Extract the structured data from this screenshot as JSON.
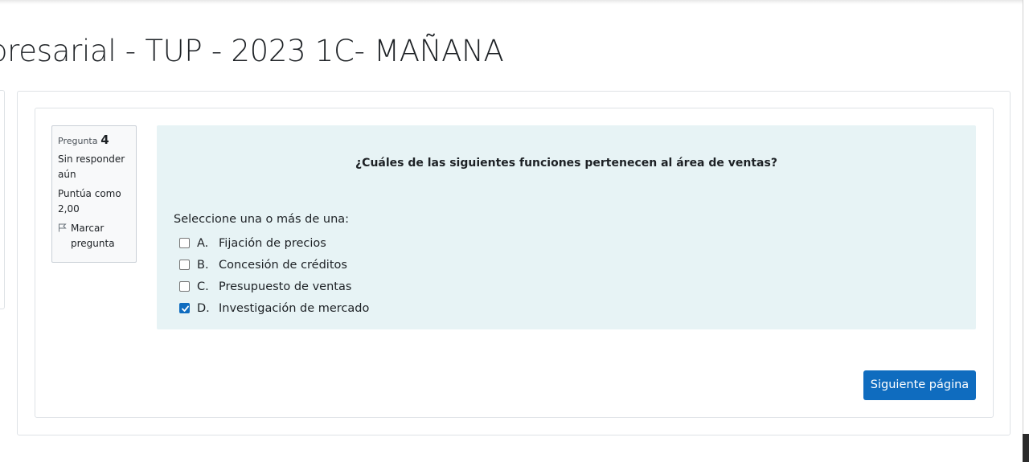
{
  "page": {
    "title": "presarial - TUP - 2023 1C- MAÑANA"
  },
  "question_info": {
    "label": "Pregunta",
    "number": "4",
    "state": "Sin responder aún",
    "grade": "Puntúa como 2,00",
    "flag_label": "Marcar pregunta",
    "flag_icon": "flag-icon"
  },
  "question": {
    "text": "¿Cuáles de las siguientes funciones pertenecen al área de ventas?",
    "prompt": "Seleccione una o más de una:",
    "answers": [
      {
        "letter": "A.",
        "label": "Fijación de precios",
        "checked": false
      },
      {
        "letter": "B.",
        "label": "Concesión de créditos",
        "checked": false
      },
      {
        "letter": "C.",
        "label": "Presupuesto de ventas",
        "checked": false
      },
      {
        "letter": "D.",
        "label": "Investigación de mercado",
        "checked": true
      }
    ]
  },
  "navigation": {
    "next_label": "Siguiente página"
  },
  "colors": {
    "primary": "#0f6cbf",
    "formulation_bg": "#e7f3f5",
    "info_bg": "#f8f9fa"
  }
}
